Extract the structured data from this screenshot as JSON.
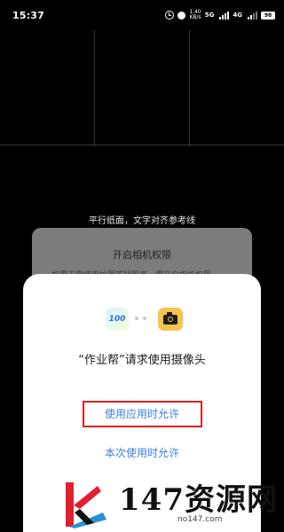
{
  "status_bar": {
    "time": "15:37",
    "speed_value": "1.40",
    "speed_unit": "KB/s",
    "network_1": "5G",
    "network_2": "4G",
    "battery": "98",
    "icons": [
      "alarm-icon",
      "dnd-icon",
      "signal-icon",
      "battery-icon"
    ]
  },
  "camera": {
    "guide_text": "平行纸面，文字对齐参考线"
  },
  "permission_card": {
    "title": "开启相机权限",
    "description": "如需正常使用拍照答疑服务，需开启相机权限"
  },
  "dialog": {
    "title": "“作业帮”请求使用摄像头",
    "allow_while_using": "使用应用时允许",
    "allow_once": "本次使用时允许",
    "app_icon_text": "100",
    "camera_icon": "camera-icon",
    "highlight_color": "#e02020",
    "link_color": "#3e7ee6"
  },
  "watermark": {
    "text": "147资源网",
    "domain": "no147.com"
  }
}
